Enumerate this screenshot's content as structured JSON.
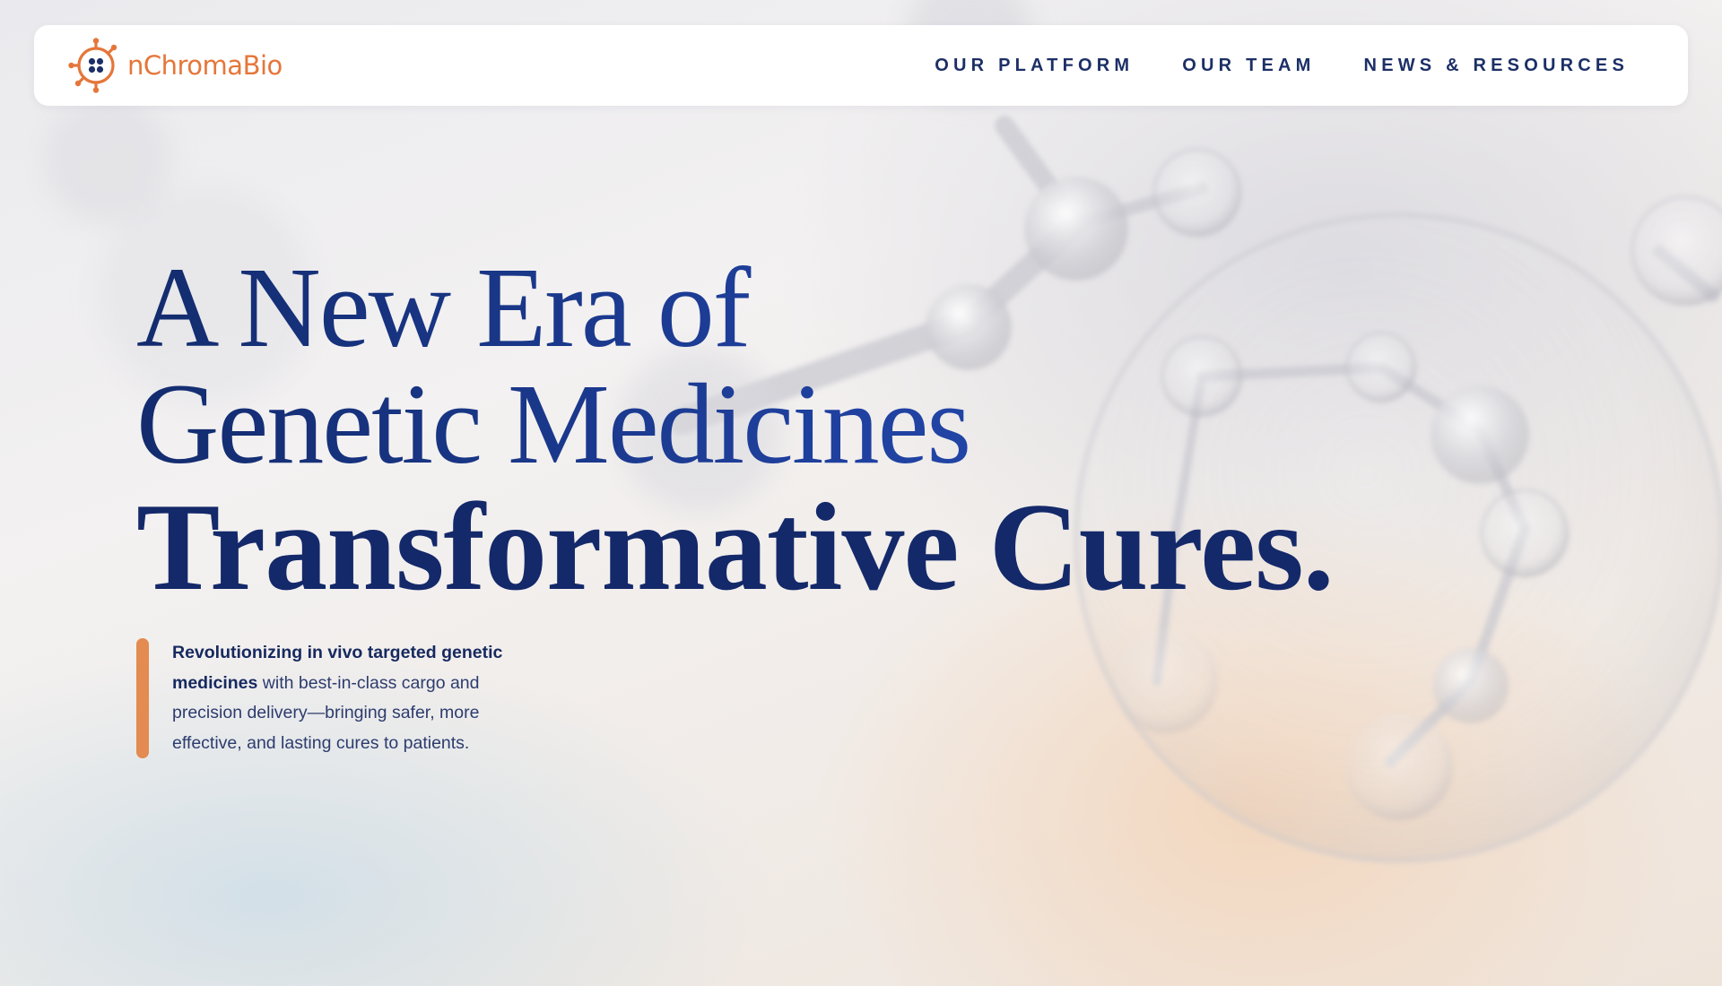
{
  "brand": {
    "name_part_1": "nChroma",
    "name_part_2": "Bio",
    "accent_color": "#e5763a",
    "icon": "nchromabio-logo-icon"
  },
  "nav": {
    "items": [
      {
        "label": "OUR PLATFORM"
      },
      {
        "label": "OUR TEAM"
      },
      {
        "label": "NEWS & RESOURCES"
      }
    ],
    "text_color": "#1c2f66"
  },
  "hero": {
    "headline_line_1": "A New Era of",
    "headline_line_2": "Genetic Medicines",
    "headline_line_3": "Transformative Cures.",
    "lede_strong": "Revolutionizing in vivo targeted genetic medicines",
    "lede_rest": " with best-in-class cargo and precision delivery—bringing safer, more effective, and lasting cures to patients.",
    "accent_bar_color": "#e38b50",
    "headline_color": "#14296a"
  }
}
